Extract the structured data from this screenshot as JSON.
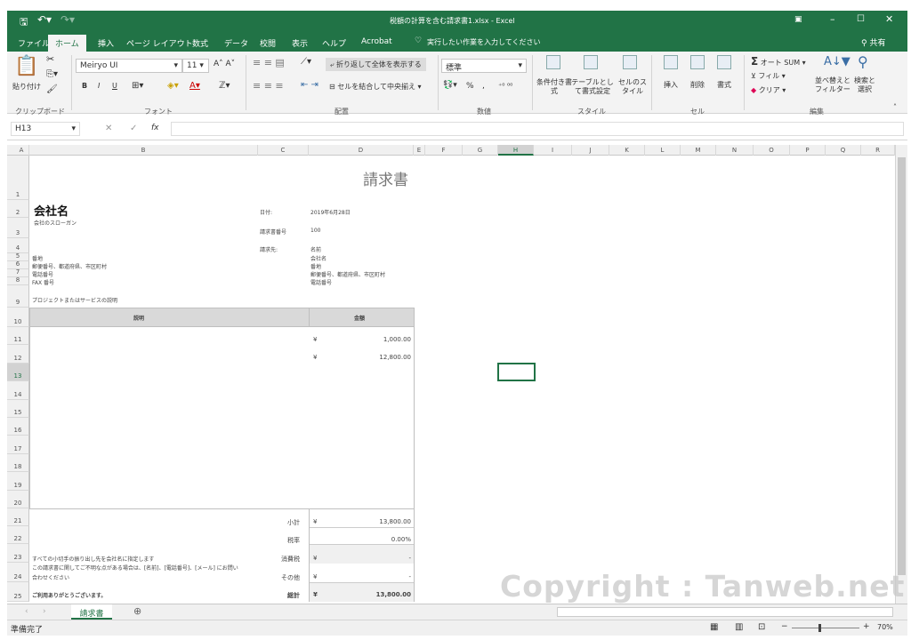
{
  "window": {
    "title": "税額の計算を含む請求書1.xlsx - Excel",
    "share": "共有"
  },
  "ribbon_tabs": [
    "ファイル",
    "ホーム",
    "挿入",
    "ページ レイアウト",
    "数式",
    "データ",
    "校閲",
    "表示",
    "ヘルプ",
    "Acrobat"
  ],
  "tell_me": "実行したい作業を入力してください",
  "ribbon": {
    "clipboard": {
      "paste": "貼り付け",
      "group": "クリップボード"
    },
    "font": {
      "name": "Meiryo UI",
      "size": "11",
      "group": "フォント",
      "bold": "B",
      "italic": "I",
      "underline": "U"
    },
    "alignment": {
      "wrap": "折り返して全体を表示する",
      "merge": "セルを結合して中央揃え",
      "group": "配置"
    },
    "number": {
      "format": "標準",
      "percent": "%",
      "comma": ",",
      "group": "数値"
    },
    "styles": {
      "conditional": "条件付き書式",
      "table": "テーブルとして書式設定",
      "cell_style": "セルのスタイル",
      "group": "スタイル"
    },
    "cells": {
      "insert": "挿入",
      "delete": "削除",
      "format": "書式",
      "group": "セル"
    },
    "editing": {
      "autosum": "オート SUM",
      "fill": "フィル",
      "clear": "クリア",
      "sort": "並べ替えとフィルター",
      "find": "検索と選択",
      "group": "編集"
    }
  },
  "formula_bar": {
    "name_box": "H13",
    "fx": "fx",
    "value": ""
  },
  "columns": [
    "A",
    "B",
    "C",
    "D",
    "E",
    "F",
    "G",
    "H",
    "I",
    "J",
    "K",
    "L",
    "M",
    "N",
    "O",
    "P",
    "Q",
    "R"
  ],
  "selected_column": "H",
  "rows": [
    "1",
    "2",
    "3",
    "4",
    "5",
    "6",
    "7",
    "8",
    "9",
    "10",
    "11",
    "12",
    "13",
    "14",
    "15",
    "16",
    "17",
    "18",
    "19",
    "20",
    "21",
    "22",
    "23",
    "24",
    "25"
  ],
  "selected_row": "13",
  "invoice": {
    "title": "請求書",
    "company": "会社名",
    "slogan": "会社のスローガン",
    "address_lines": [
      "番地",
      "郵便番号、都道府県、市区町村",
      "電話番号",
      "FAX 番号"
    ],
    "date_label": "日付:",
    "date": "2019年6月28日",
    "number_label": "請求書番号",
    "number": "100",
    "billto_label": "請求先:",
    "billto_lines": [
      "名前",
      "会社名",
      "番地",
      "郵便番号、都道府県、市区町村",
      "電話番号"
    ],
    "project": "プロジェクトまたはサービスの説明",
    "col_desc": "説明",
    "col_amount": "金額",
    "items": [
      {
        "yen": "¥",
        "amount": "1,000.00"
      },
      {
        "yen": "¥",
        "amount": "12,800.00"
      }
    ],
    "subtotal_label": "小計",
    "subtotal": "13,800.00",
    "taxrate_label": "税率",
    "taxrate": "0.00%",
    "tax_label": "消費税",
    "tax": "-",
    "other_label": "その他",
    "other": "-",
    "total_label": "総計",
    "total": "13,800.00",
    "yen": "¥",
    "note1": "すべての小切手の振り出し先を会社名に指定します",
    "note2": "この請求書に関してご不明な点がある場合は、[名前]、[電話番号]、[メール] にお問い",
    "note3": "合わせください",
    "thanks": "ご利用ありがとうございます。"
  },
  "sheet_tab": "請求書",
  "status": {
    "ready": "準備完了",
    "zoom": "70%"
  },
  "watermark": "Copyright : Tanweb.net",
  "colors": {
    "accent": "#217346"
  }
}
